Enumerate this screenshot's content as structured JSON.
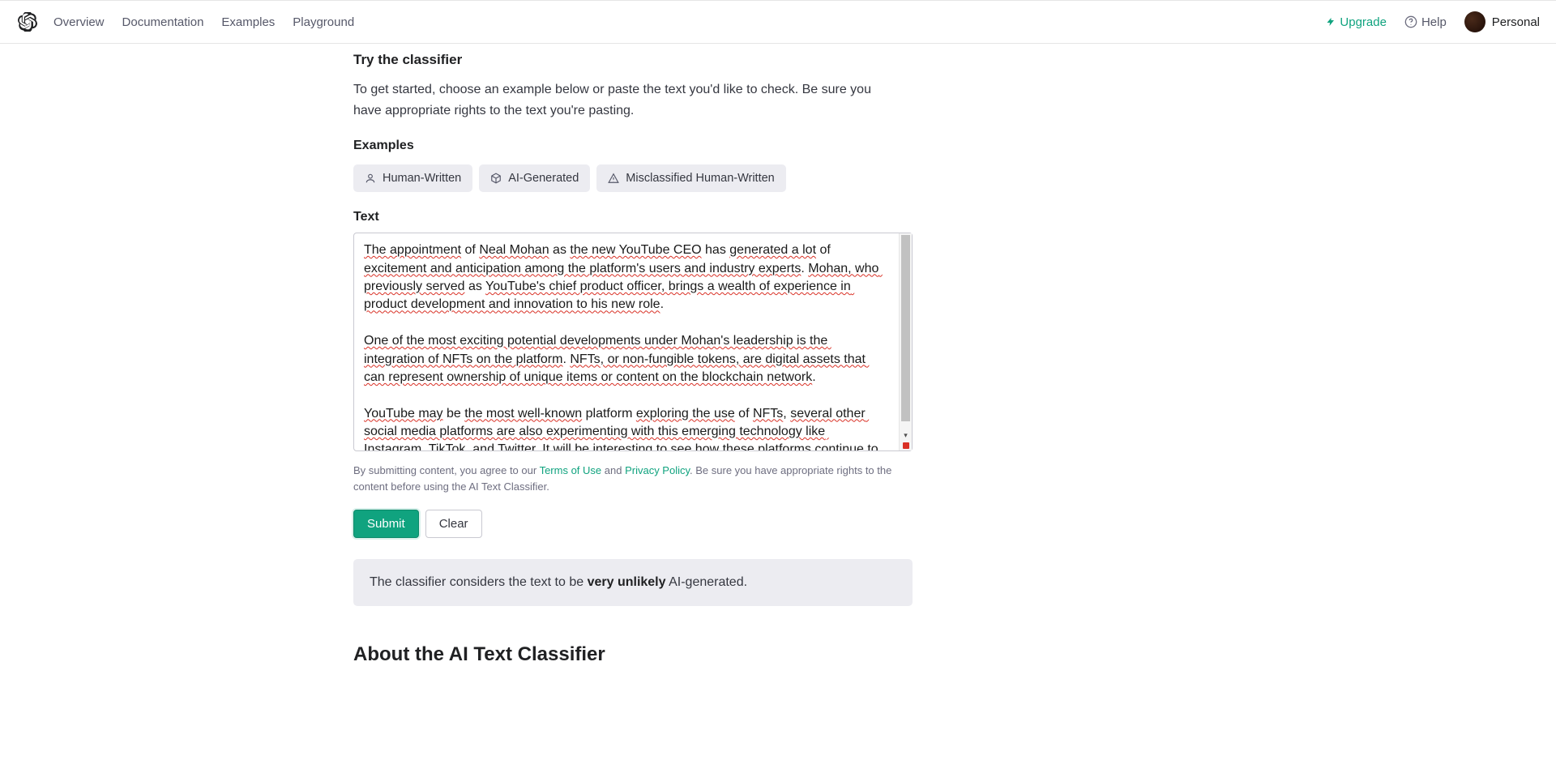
{
  "nav": {
    "links": [
      "Overview",
      "Documentation",
      "Examples",
      "Playground"
    ],
    "upgrade": "Upgrade",
    "help": "Help",
    "account": "Personal"
  },
  "try_heading": "Try the classifier",
  "intro": "To get started, choose an example below or paste the text you'd like to check. Be sure you have appropriate rights to the text you're pasting.",
  "examples_heading": "Examples",
  "chips": {
    "human": "Human-Written",
    "ai": "AI-Generated",
    "misclass": "Misclassified Human-Written"
  },
  "text_heading": "Text",
  "textarea_value": "The appointment of Neal Mohan as the new YouTube CEO has generated a lot of excitement and anticipation among the platform's users and industry experts. Mohan, who previously served as YouTube's chief product officer, brings a wealth of experience in product development and innovation to his new role.\n\nOne of the most exciting potential developments under Mohan's leadership is the integration of NFTs on the platform. NFTs, or non-fungible tokens, are digital assets that can represent ownership of unique items or content on the blockchain network.\n\nYouTube may be the most well-known platform exploring the use of NFTs, several other social media platforms are also experimenting with this emerging technology like Instagram, TikTok, and Twitter. It will be interesting to see how these platforms continue to integrate NFTs in the coming years, and how this will impact the way we consume and interact with social media content.",
  "legal": {
    "prefix": "By submitting content, you agree to our ",
    "terms": "Terms of Use",
    "and": " and ",
    "privacy": "Privacy Policy",
    "suffix": ". Be sure you have appropriate rights to the content before using the AI Text Classifier."
  },
  "buttons": {
    "submit": "Submit",
    "clear": "Clear"
  },
  "result": {
    "prefix": "The classifier considers the text to be ",
    "verdict": "very unlikely",
    "suffix": " AI-generated."
  },
  "about_heading": "About the AI Text Classifier"
}
